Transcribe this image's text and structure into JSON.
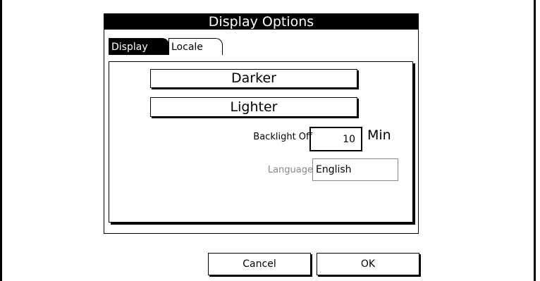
{
  "window": {
    "title": "Display Options"
  },
  "tabs": [
    {
      "label": "Display",
      "active": true
    },
    {
      "label": "Locale",
      "active": false
    }
  ],
  "panel": {
    "darker_label": "Darker",
    "lighter_label": "Lighter",
    "backlight_label": "Backlight Off",
    "backlight_value": "10",
    "backlight_unit": "Min",
    "language_label": "Language",
    "language_value": "English"
  },
  "footer": {
    "cancel_label": "Cancel",
    "ok_label": "OK"
  },
  "colors": {
    "titlebar_bg": "#000000",
    "titlebar_fg": "#ffffff",
    "disabled_text": "#888888"
  }
}
